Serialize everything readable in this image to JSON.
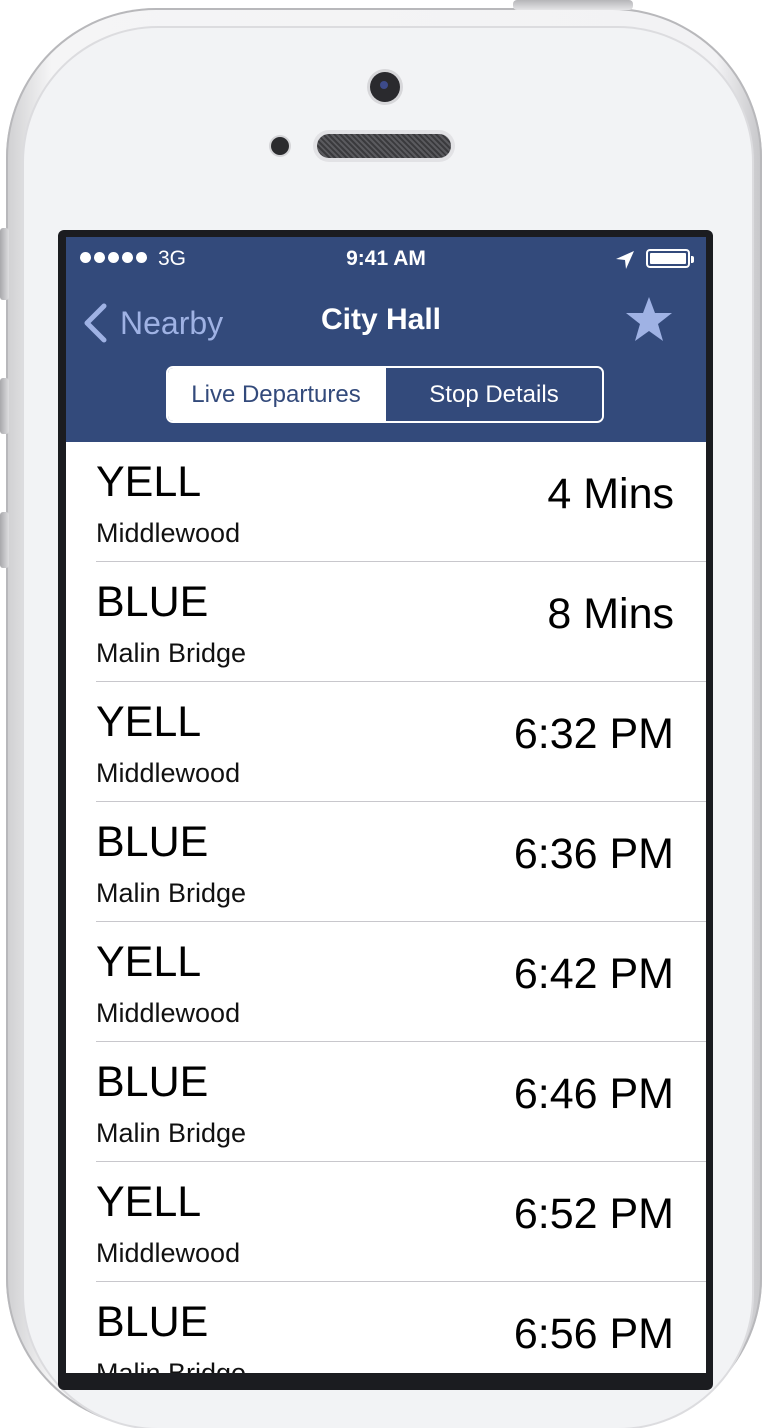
{
  "status_bar": {
    "signal_dots": 5,
    "carrier": "3G",
    "time": "9:41 AM",
    "location_icon": "location-arrow-icon",
    "battery_level": 1.0
  },
  "nav": {
    "back_label": "Nearby",
    "title": "City Hall",
    "favorite_icon": "star-icon"
  },
  "segments": {
    "live": "Live Departures",
    "details": "Stop Details",
    "selected": "live"
  },
  "departures": [
    {
      "route": "YELL",
      "destination": "Middlewood",
      "time": "4 Mins"
    },
    {
      "route": "BLUE",
      "destination": "Malin Bridge",
      "time": "8 Mins"
    },
    {
      "route": "YELL",
      "destination": "Middlewood",
      "time": "6:32 PM"
    },
    {
      "route": "BLUE",
      "destination": "Malin Bridge",
      "time": "6:36 PM"
    },
    {
      "route": "YELL",
      "destination": "Middlewood",
      "time": "6:42 PM"
    },
    {
      "route": "BLUE",
      "destination": "Malin Bridge",
      "time": "6:46 PM"
    },
    {
      "route": "YELL",
      "destination": "Middlewood",
      "time": "6:52 PM"
    },
    {
      "route": "BLUE",
      "destination": "Malin Bridge",
      "time": "6:56 PM"
    }
  ],
  "colors": {
    "header": "#334a7b",
    "back_tint": "#9fb2e4",
    "star": "#9fb2e4"
  }
}
